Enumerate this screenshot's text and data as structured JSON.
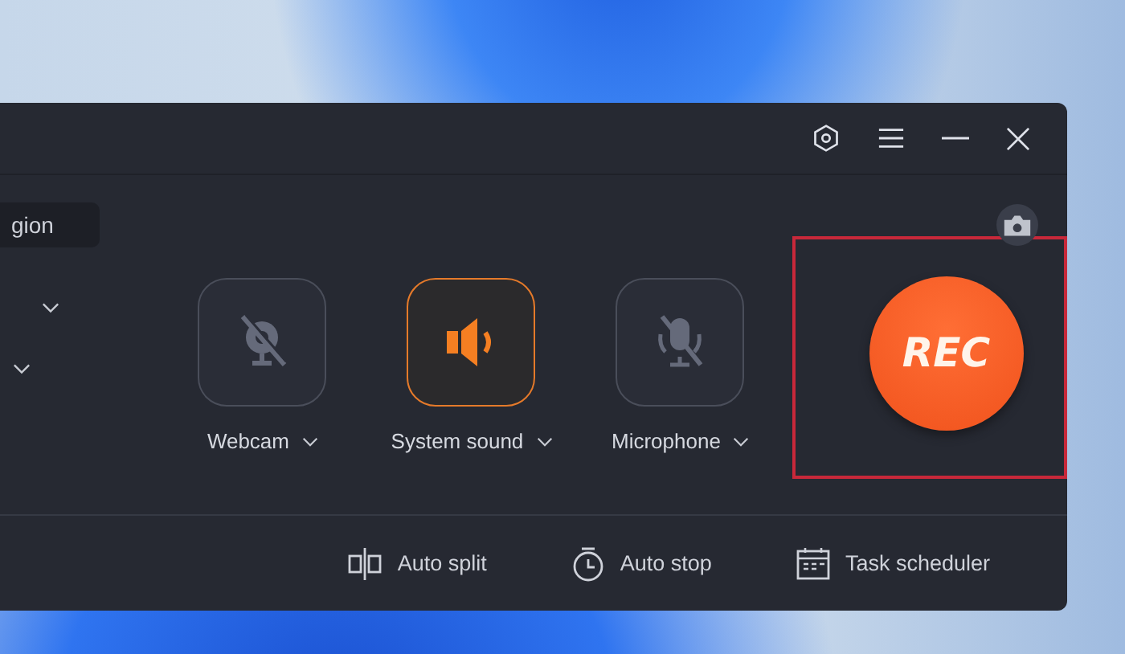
{
  "region_field": {
    "value": "gion"
  },
  "dropdowns": [
    {
      "expanded": false
    },
    {
      "expanded": false
    }
  ],
  "devices": [
    {
      "kind": "webcam",
      "label": "Webcam",
      "on": false
    },
    {
      "kind": "speaker",
      "label": "System sound",
      "on": true
    },
    {
      "kind": "microphone",
      "label": "Microphone",
      "on": false
    }
  ],
  "rec_button": {
    "label": "REC",
    "highlighted": true
  },
  "tools": [
    {
      "kind": "split",
      "label": "Auto split"
    },
    {
      "kind": "timer",
      "label": "Auto stop"
    },
    {
      "kind": "calendar",
      "label": "Task scheduler"
    }
  ]
}
